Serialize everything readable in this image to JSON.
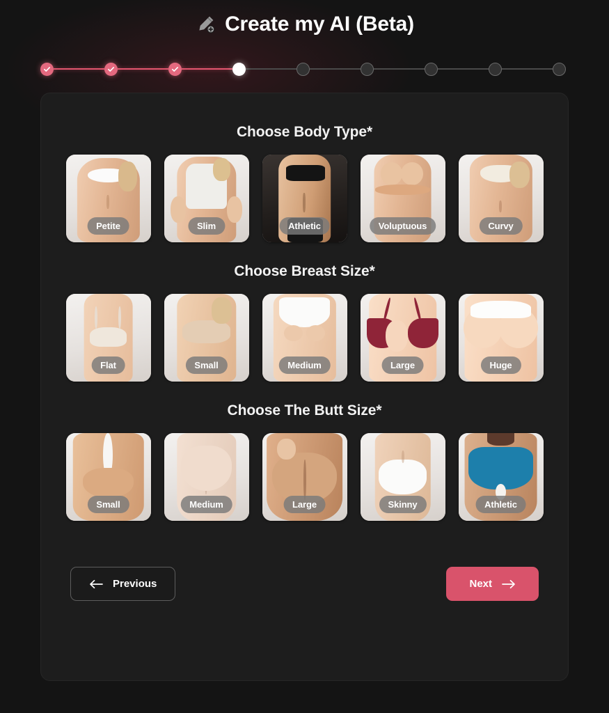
{
  "header": {
    "icon": "pencil-plus-icon",
    "title": "Create my AI (Beta)"
  },
  "stepper": {
    "total_steps": 9,
    "current_step": 4,
    "completed_steps": 3,
    "done_color": "#e4697f",
    "current_color": "#ffffff",
    "todo_color": "#323232",
    "steps": [
      {
        "index": 1,
        "state": "done"
      },
      {
        "index": 2,
        "state": "done"
      },
      {
        "index": 3,
        "state": "done"
      },
      {
        "index": 4,
        "state": "current"
      },
      {
        "index": 5,
        "state": "todo"
      },
      {
        "index": 6,
        "state": "todo"
      },
      {
        "index": 7,
        "state": "todo"
      },
      {
        "index": 8,
        "state": "todo"
      },
      {
        "index": 9,
        "state": "todo"
      }
    ]
  },
  "sections": [
    {
      "id": "body-type",
      "title": "Choose Body Type*",
      "options": [
        {
          "label": "Petite",
          "selected": false
        },
        {
          "label": "Slim",
          "selected": false
        },
        {
          "label": "Athletic",
          "selected": false
        },
        {
          "label": "Voluptuous",
          "selected": false
        },
        {
          "label": "Curvy",
          "selected": false
        }
      ]
    },
    {
      "id": "breast-size",
      "title": "Choose Breast Size*",
      "options": [
        {
          "label": "Flat",
          "selected": false
        },
        {
          "label": "Small",
          "selected": false
        },
        {
          "label": "Medium",
          "selected": false
        },
        {
          "label": "Large",
          "selected": false
        },
        {
          "label": "Huge",
          "selected": false
        }
      ]
    },
    {
      "id": "butt-size",
      "title": "Choose The Butt Size*",
      "options": [
        {
          "label": "Small",
          "selected": false
        },
        {
          "label": "Medium",
          "selected": false
        },
        {
          "label": "Large",
          "selected": false
        },
        {
          "label": "Skinny",
          "selected": false
        },
        {
          "label": "Athletic",
          "selected": false
        }
      ]
    }
  ],
  "footer": {
    "previous_label": "Previous",
    "next_label": "Next",
    "next_color": "#d9536b"
  }
}
